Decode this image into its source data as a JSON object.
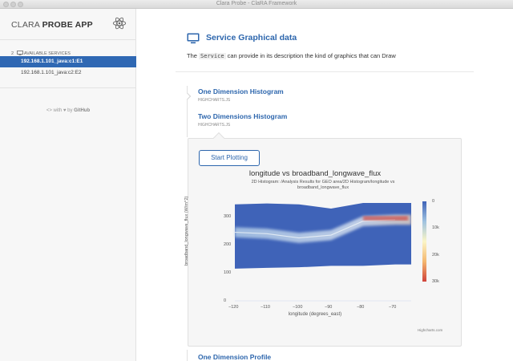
{
  "window": {
    "title": "Clara Probe - ClaRA Framework"
  },
  "sidebar": {
    "app_title_light": "CLARA",
    "app_title_bold": "PROBE APP",
    "available_count": "2",
    "available_label": "AVAILABLE SERVICES",
    "services": [
      {
        "label": "192.168.1.101_java:c1:E1",
        "active": true
      },
      {
        "label": "192.168.1.101_java:c2:E2",
        "active": false
      }
    ],
    "credit_with": "with",
    "credit_by": "by",
    "credit_github": "GitHub"
  },
  "main": {
    "title": "Service Graphical data",
    "desc_pre": "The",
    "desc_code": "Service",
    "desc_post": "can provide in its description the kind of graphics that can Draw",
    "items": [
      {
        "title": "One Dimension Histogram",
        "sub": "HIGHCHARTS.JS"
      },
      {
        "title": "Two Dimensions Histogram",
        "sub": "HIGHCHARTS.JS"
      }
    ],
    "plot_button": "Start Plotting",
    "last_item": "One Dimension Profile"
  },
  "chart_data": {
    "type": "heatmap",
    "title": "longitude vs broadband_longwave_flux",
    "subtitle": "2D Histogram: /Analysis Results for GEO area/2D Histogram/longitude vs broadband_longwave_flux",
    "xlabel": "longitude (degrees_east)",
    "ylabel": "broadband_longwave_flux (W/m^2)",
    "xlim": [
      -120,
      -65
    ],
    "ylim": [
      0,
      370
    ],
    "x_ticks": [
      "−120",
      "−110",
      "−100",
      "−90",
      "−80",
      "−70"
    ],
    "y_ticks": [
      "0",
      "100",
      "200",
      "300"
    ],
    "colorbar": {
      "ticks": [
        "0",
        "10k",
        "20k",
        "30k"
      ],
      "range": [
        0,
        30000
      ],
      "colors": [
        "#3f63b8",
        "#9fc2e0",
        "#fbf5c7",
        "#f4b76f",
        "#d0433a"
      ]
    },
    "density_profile": [
      {
        "lon": -120,
        "low": 115,
        "high": 345,
        "ridge": 245
      },
      {
        "lon": -110,
        "low": 118,
        "high": 348,
        "ridge": 240
      },
      {
        "lon": -100,
        "low": 120,
        "high": 345,
        "ridge": 225
      },
      {
        "lon": -90,
        "low": 125,
        "high": 330,
        "ridge": 235
      },
      {
        "lon": -80,
        "low": 125,
        "high": 350,
        "ridge": 285
      },
      {
        "lon": -70,
        "low": 130,
        "high": 350,
        "ridge": 290
      }
    ],
    "hotspot": {
      "lon_range": [
        -80,
        -66
      ],
      "flux": 295,
      "count": 30000
    },
    "credits": "Highcharts.com"
  }
}
